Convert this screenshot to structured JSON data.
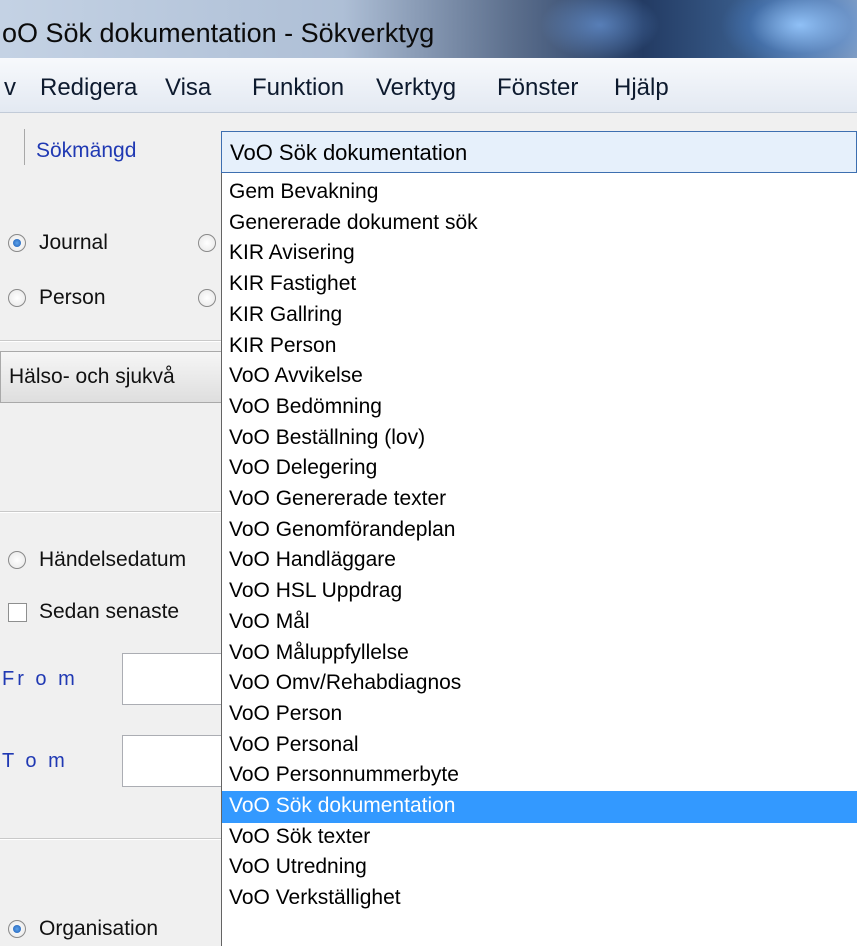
{
  "window": {
    "title": "oO Sök dokumentation - Sökverktyg"
  },
  "menu": {
    "items": [
      "v",
      "Redigera",
      "Visa",
      "Funktion",
      "Verktyg",
      "Fönster",
      "Hjälp"
    ]
  },
  "toolbar": {
    "sokmangd_label": "Sökmängd",
    "combo_value": "VoO Sök dokumentation"
  },
  "left_panel": {
    "radio_journal": "Journal",
    "radio_person": "Person",
    "field_button": "Hälso- och sjukvå",
    "radio_handelsedatum": "Händelsedatum",
    "checkbox_sedan_senaste": "Sedan senaste",
    "from_label": "Fr o m",
    "tom_label": "T o m",
    "radio_organisation": "Organisation"
  },
  "dropdown": {
    "selected_index": 21,
    "items": [
      "Gem Bevakning",
      "Genererade dokument sök",
      "KIR Avisering",
      "KIR Fastighet",
      "KIR Gallring",
      "KIR Person",
      "VoO Avvikelse",
      "VoO Bedömning",
      "VoO Beställning (lov)",
      "VoO Delegering",
      "VoO Genererade texter",
      "VoO Genomförandeplan",
      "VoO Handläggare",
      "VoO HSL Uppdrag",
      "VoO Mål",
      "VoO Måluppfyllelse",
      "VoO Omv/Rehabdiagnos",
      "VoO Person",
      "VoO Personal",
      "VoO Personnummerbyte",
      "VoO Sök dokumentation",
      "VoO Sök texter",
      "VoO Utredning",
      "VoO Verkställighet"
    ]
  },
  "colors": {
    "selection": "#3399ff",
    "label_blue": "#2039b3",
    "combo_border": "#3d6fb0"
  }
}
